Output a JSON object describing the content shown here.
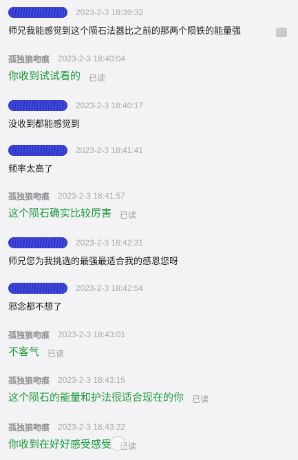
{
  "messages": [
    {
      "type": "in",
      "sender": "",
      "time": "2023-2-3 18:39:32",
      "text": "师兄我能感觉到这个陨石法器比之前的那两个陨铁的能量强"
    },
    {
      "type": "out",
      "sender": "孤独狼吻痕",
      "time": "2023-2-3 18:40:04",
      "text": "你收到试试看的",
      "read": "已读"
    },
    {
      "type": "in",
      "sender": "",
      "time": "2023-2-3 18:40:17",
      "text": "没收到都能感觉到"
    },
    {
      "type": "in",
      "sender": "",
      "time": "2023-2-3 18:41:41",
      "text": "频率太高了"
    },
    {
      "type": "out",
      "sender": "孤独狼吻痕",
      "time": "2023-2-3 18:41:57",
      "text": "这个陨石确实比较厉害",
      "read": "已读"
    },
    {
      "type": "in",
      "sender": "",
      "time": "2023-2-3 18:42:31",
      "text": "师兄您为我挑选的最强最适合我的感恩您呀"
    },
    {
      "type": "in",
      "sender": "",
      "time": "2023-2-3 18:42:54",
      "text": "邪念都不想了"
    },
    {
      "type": "out",
      "sender": "孤独狼吻痕",
      "time": "2023-2-3 18:43:01",
      "text": "不客气",
      "read": "已读"
    },
    {
      "type": "out",
      "sender": "孤独狼吻痕",
      "time": "2023-2-3 18:43:15",
      "text": "这个陨石的能量和护法很适合现在的你",
      "read": "已读"
    },
    {
      "type": "out",
      "sender": "孤独狼吻痕",
      "time": "2023-2-3 18:43:22",
      "text": "你收到在好好感受感受",
      "read": "已读"
    }
  ],
  "more_button": "···"
}
